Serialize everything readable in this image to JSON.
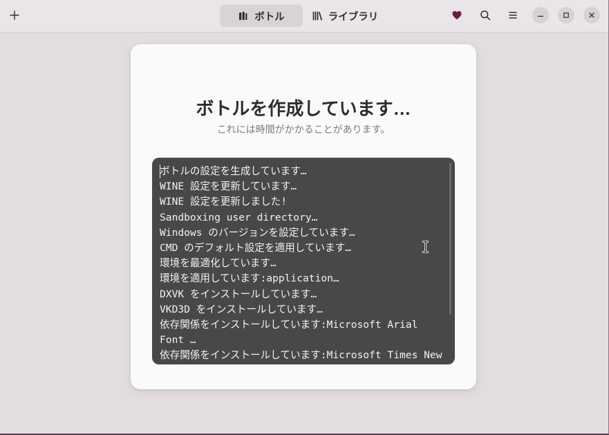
{
  "headerbar": {
    "new_button": {
      "icon": "plus-icon"
    },
    "tabs": [
      {
        "label": "ボトル",
        "icon": "bottles-icon",
        "selected": true
      },
      {
        "label": "ライブラリ",
        "icon": "library-icon",
        "selected": false
      }
    ],
    "actions": {
      "donate": {
        "icon": "heart-icon"
      },
      "search": {
        "icon": "search-icon"
      },
      "menu": {
        "icon": "open-menu-icon"
      }
    },
    "window_controls": {
      "minimize": {
        "icon": "minimize-icon"
      },
      "maximize": {
        "icon": "maximize-icon"
      },
      "close": {
        "icon": "close-icon"
      }
    }
  },
  "dialog": {
    "title": "ボトルを作成しています…",
    "subtitle": "これには時間がかかることがあります。",
    "log": [
      "ボトルの設定を生成しています…",
      "WINE 設定を更新しています…",
      "WINE 設定を更新しました!",
      "Sandboxing user directory…",
      "Windows のバージョンを設定しています…",
      "CMD のデフォルト設定を適用しています…",
      "環境を最適化しています…",
      "環境を適用しています:application…",
      "DXVK をインストールしています…",
      "VKD3D をインストールしています…",
      "依存関係をインストールしています:Microsoft Arial Font …",
      "依存関係をインストールしています:Microsoft Times New"
    ]
  },
  "colors": {
    "window_bg": "#e3dde1",
    "headerbar_bg": "#eae5e8",
    "selected_tab_bg": "#d9d3d7",
    "card_bg": "#fafafa",
    "heart": "#6b1c45",
    "log_bg": "#484848",
    "log_text": "#f2f2f2",
    "subtitle_text": "#7b7b7b",
    "window_control_bg": "#d8d2d6"
  }
}
